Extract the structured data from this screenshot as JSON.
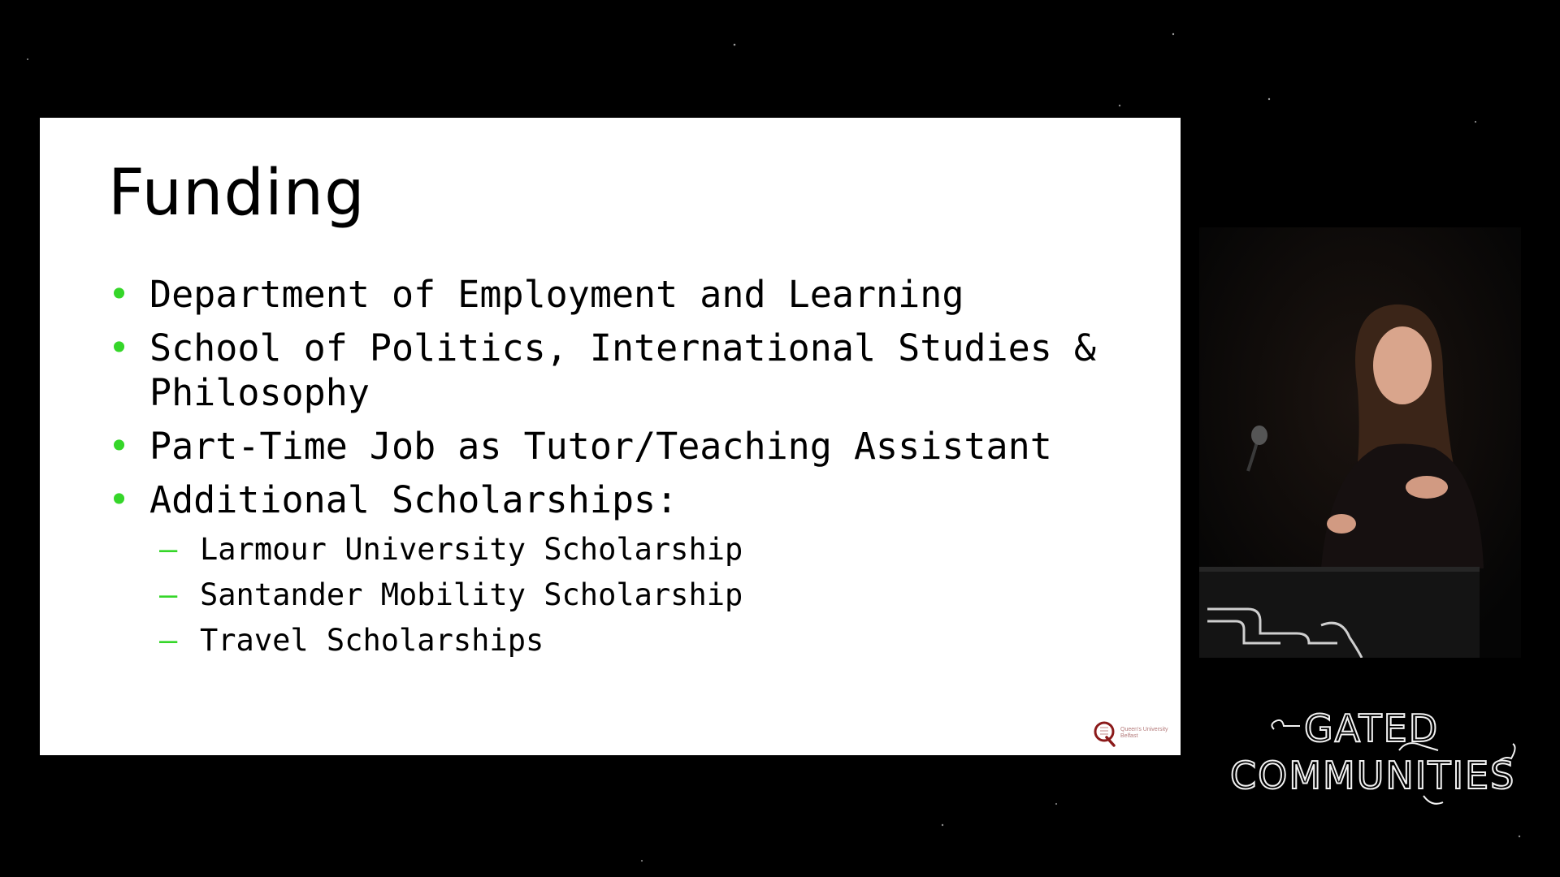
{
  "slide": {
    "title": "Funding",
    "bullets": [
      {
        "text": "Department of Employment and Learning"
      },
      {
        "text": "School of Politics, International Studies & Philosophy"
      },
      {
        "text": "Part-Time Job as Tutor/Teaching Assistant"
      },
      {
        "text": "Additional Scholarships:",
        "sub": [
          "Larmour University Scholarship",
          "Santander Mobility Scholarship",
          "Travel Scholarships"
        ]
      }
    ],
    "bullet_symbol": "•",
    "sub_symbol": "–",
    "accent_color": "#35d629",
    "logo": {
      "letter": "Q",
      "text": "Queen's University Belfast",
      "color": "#8b1a1a"
    }
  },
  "event_logo": {
    "line1": "GATED",
    "line2": "COMMUNITIES"
  },
  "colors": {
    "background": "#000000",
    "slide_background": "#ffffff",
    "text": "#000000"
  }
}
